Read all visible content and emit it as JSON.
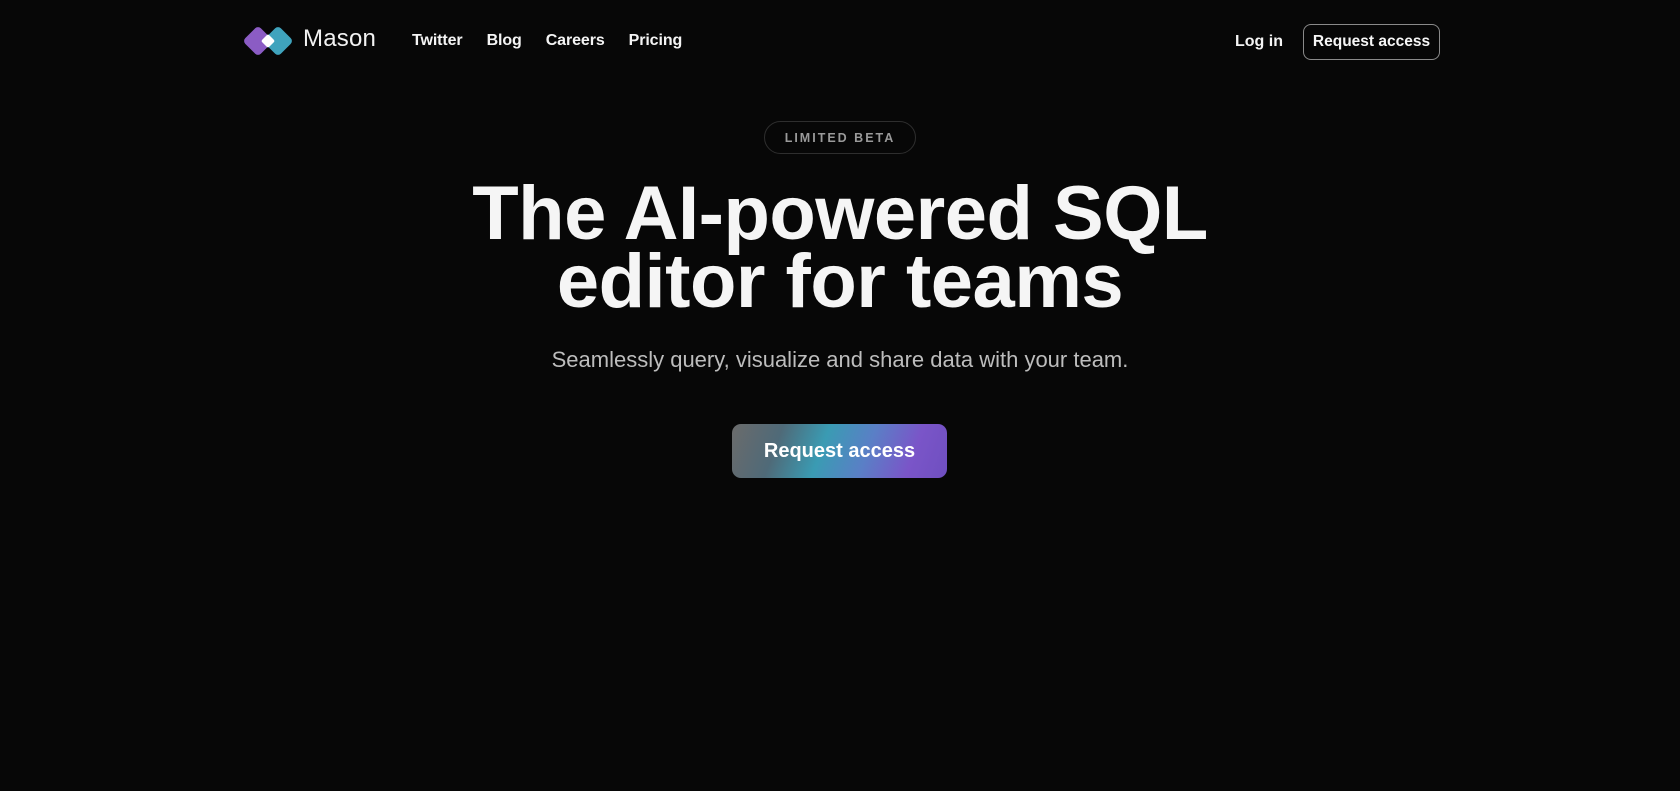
{
  "brand": {
    "name": "Mason",
    "logo_icon": "diamond-pair-logo",
    "colors": {
      "purple": "#8b5cc4",
      "teal": "#3fa3bd",
      "center": "#ffffff"
    }
  },
  "nav": {
    "links": [
      "Twitter",
      "Blog",
      "Careers",
      "Pricing"
    ],
    "login_label": "Log in",
    "request_access_label": "Request access"
  },
  "hero": {
    "badge": "LIMITED BETA",
    "headline_line1": "The AI-powered SQL",
    "headline_line2": "editor for teams",
    "subtitle": "Seamlessly query, visualize and share data with your team.",
    "cta_label": "Request access"
  },
  "theme": {
    "background": "#070707",
    "text": "#f5f5f5",
    "muted": "#bdbdbd"
  }
}
